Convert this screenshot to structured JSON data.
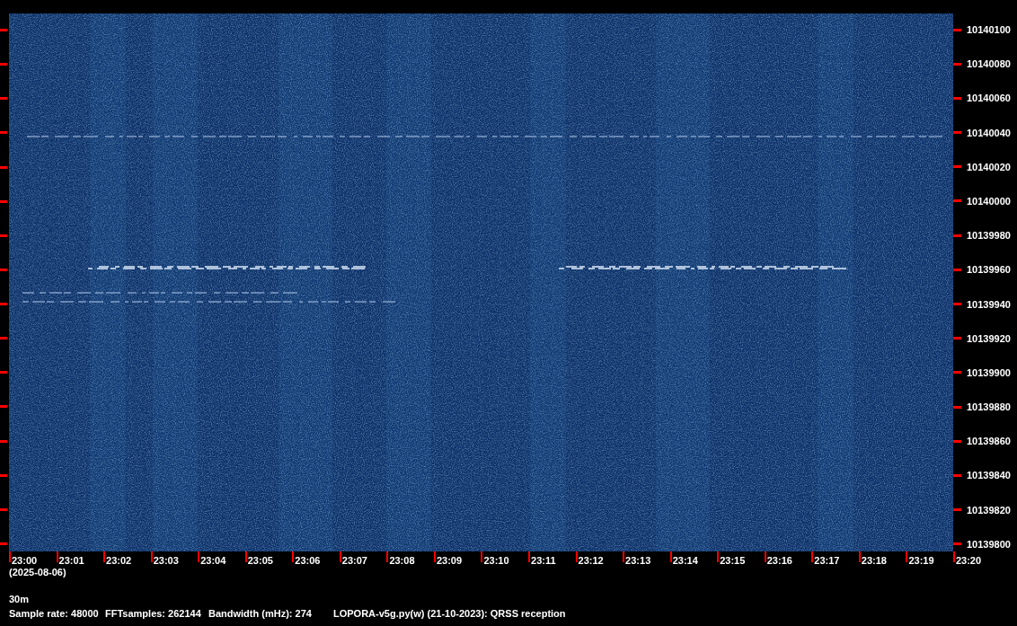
{
  "frequency_axis": {
    "labels": [
      "10140100",
      "10140080",
      "10140060",
      "10140040",
      "10140020",
      "10140000",
      "10139980",
      "10139960",
      "10139940",
      "10139920",
      "10139900",
      "10139880",
      "10139860",
      "10139840",
      "10139820",
      "10139800"
    ]
  },
  "time_axis": {
    "labels": [
      "23:00",
      "23:01",
      "23:02",
      "23:03",
      "23:04",
      "23:05",
      "23:06",
      "23:07",
      "23:08",
      "23:09",
      "23:10",
      "23:11",
      "23:12",
      "23:13",
      "23:14",
      "23:15",
      "23:16",
      "23:17",
      "23:18",
      "23:19",
      "23:20"
    ],
    "date": "(2025-08-06)"
  },
  "band": "30m",
  "info": [
    "Sample rate: 48000",
    "FFTsamples: 262144",
    "Bandwidth (mHz): 274",
    "LOPORA-v5g.py(w) (21-10-2023): QRSS reception"
  ]
}
